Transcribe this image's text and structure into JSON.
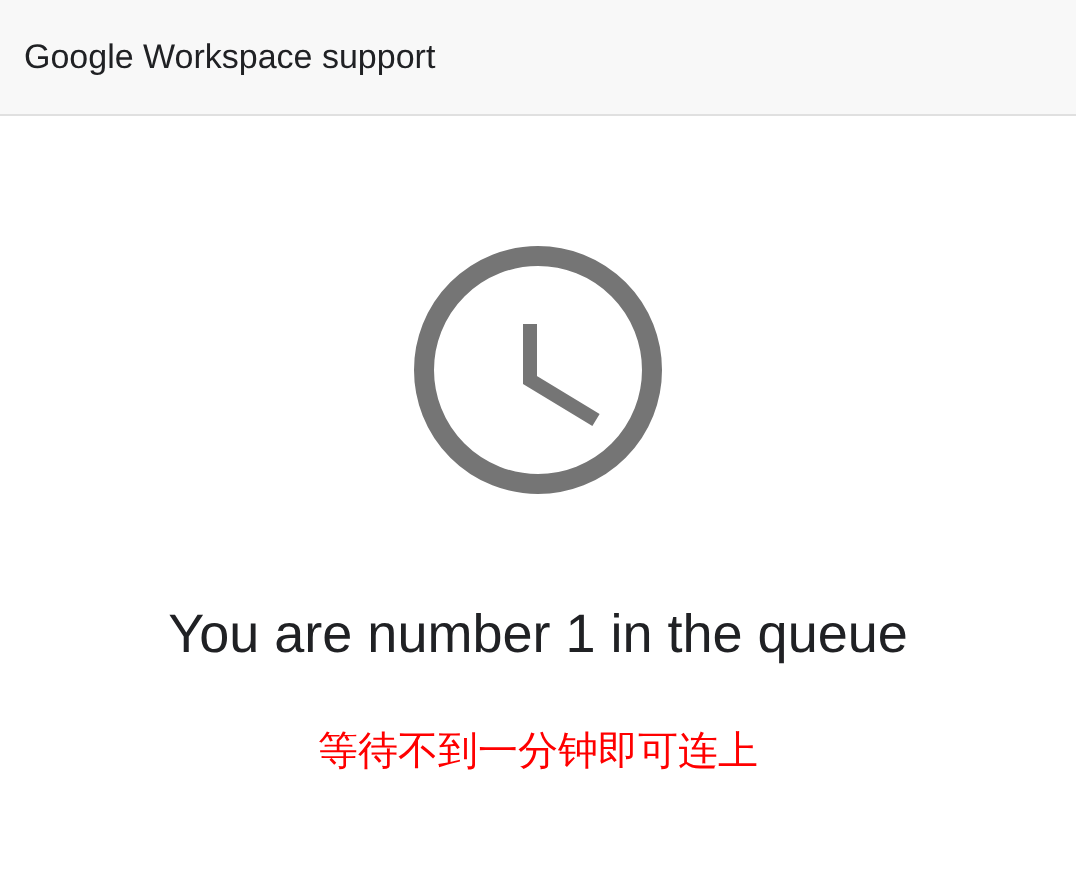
{
  "header": {
    "title": "Google Workspace support"
  },
  "queue": {
    "message": "You are number 1 in the queue",
    "note": "等待不到一分钟即可连上"
  }
}
